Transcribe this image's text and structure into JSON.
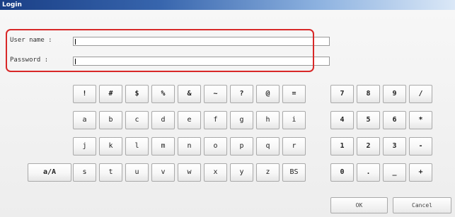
{
  "window": {
    "title": "Login"
  },
  "form": {
    "username_label": "User name :",
    "username_value": "",
    "password_label": "Password :",
    "password_value": ""
  },
  "keyboard": {
    "row1": [
      "!",
      "#",
      "$",
      "%",
      "&",
      "~",
      "?",
      "@",
      "="
    ],
    "row2": [
      "a",
      "b",
      "c",
      "d",
      "e",
      "f",
      "g",
      "h",
      "i"
    ],
    "row3": [
      "j",
      "k",
      "l",
      "m",
      "n",
      "o",
      "p",
      "q",
      "r"
    ],
    "row4": [
      "s",
      "t",
      "u",
      "v",
      "w",
      "x",
      "y",
      "z",
      "BS"
    ],
    "case_toggle": "a/A"
  },
  "keypad": {
    "row1": [
      "7",
      "8",
      "9",
      "/"
    ],
    "row2": [
      "4",
      "5",
      "6",
      "*"
    ],
    "row3": [
      "1",
      "2",
      "3",
      "-"
    ],
    "row4": [
      "0",
      ".",
      "_",
      "+"
    ]
  },
  "actions": {
    "ok": "OK",
    "cancel": "Cancel"
  },
  "colors": {
    "title_bar_start": "#1a3f86",
    "highlight": "#d82828"
  }
}
